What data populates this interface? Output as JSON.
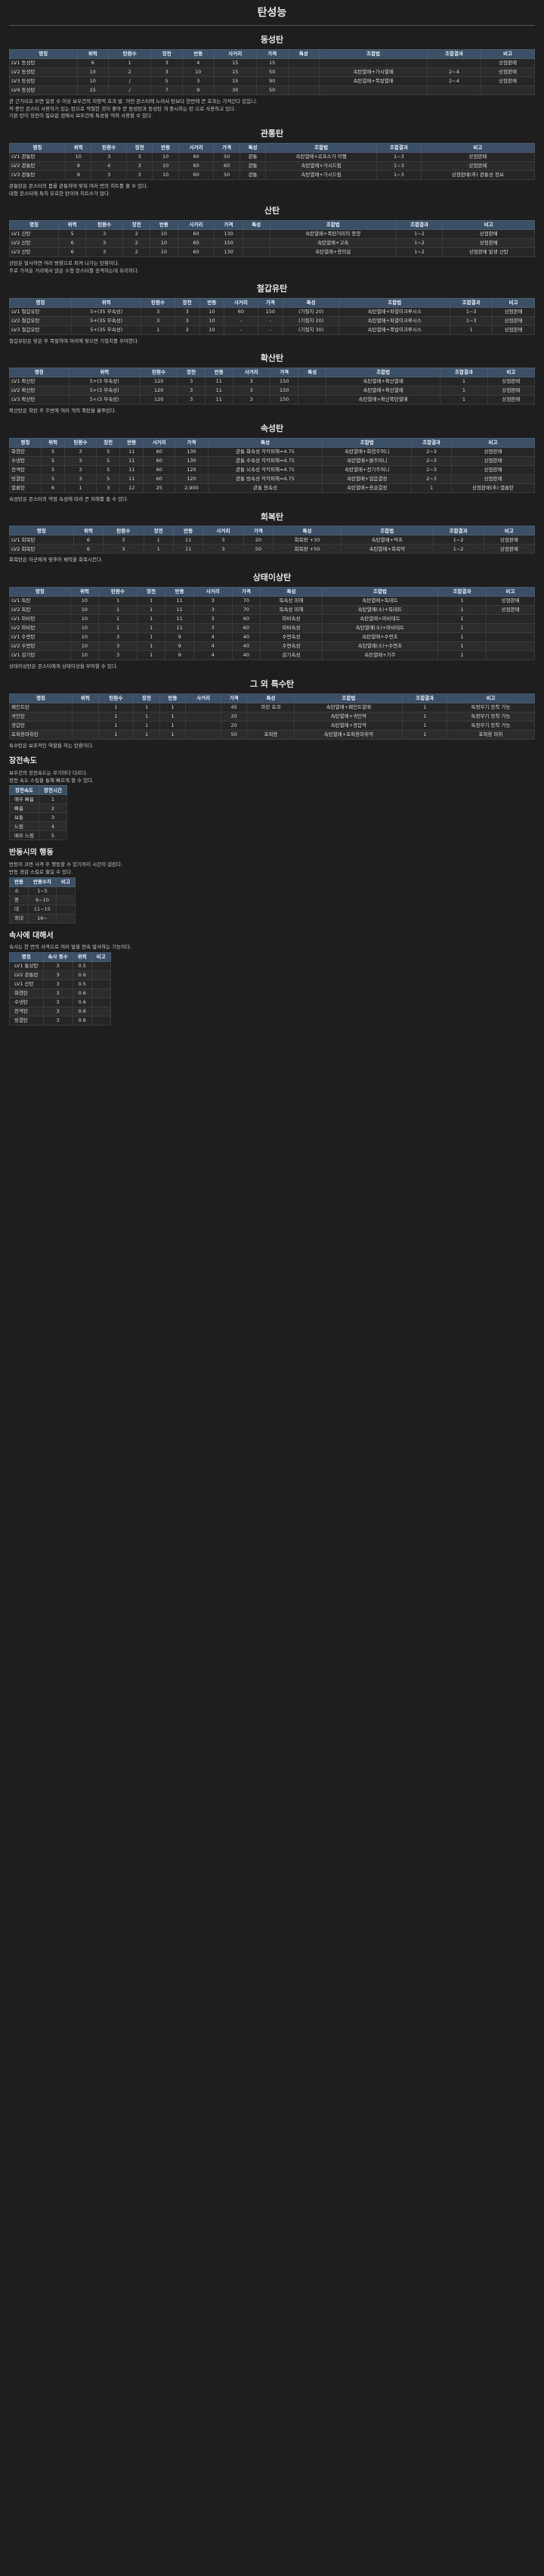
{
  "title": "탄성능",
  "sections": [
    {
      "title": "동성탄",
      "headers": [
        "명칭",
        "위력",
        "탄환수",
        "장전",
        "반동",
        "사거리",
        "가격",
        "특성",
        "조합법",
        "조합결과",
        "비고"
      ],
      "rows": [
        [
          "LV1 동성탄",
          "6",
          "1",
          "3",
          "4",
          "15",
          "15",
          "",
          "",
          "",
          "상점판매"
        ],
        [
          "LV2 동성탄",
          "10",
          "2",
          "3",
          "10",
          "15",
          "50",
          "",
          "속탄열매+가시열매",
          "2~4",
          "상점판매"
        ],
        [
          "LV3 동성탄",
          "10",
          "/",
          "5",
          "3",
          "15",
          "90",
          "",
          "속탄열매+폭발열매",
          "2~4",
          "상점판매"
        ],
        [
          "LV4 동성탄",
          "15",
          "/",
          "7",
          "9",
          "30",
          "50",
          "",
          "",
          "",
          ""
        ]
      ],
      "notes": [
        "관 근거리로 쓰면 일정 수 이상 보우건의 치명적 효과 발. 어떤 몬스터에 노려서 탄보다 한번에 큰 효과는 가져간다 있음니.",
        "적 중인 몬스터 사용하기 있는 탄으로 적절한 것이 좋아 양 동성탄과 동성탄 개 중시하는 탄 으로 사용하고 있다.",
        "기본 탄이 장전이 필요없 점에서 보우건에 특성을 익혀 사용할 수 있다."
      ]
    },
    {
      "title": "관통탄",
      "headers": [
        "명칭",
        "위력",
        "탄환수",
        "장전",
        "반동",
        "사거리",
        "가격",
        "특성",
        "조합법",
        "조합결과",
        "비고"
      ],
      "rows": [
        [
          "LV1 관통탄",
          "10",
          "3",
          "3",
          "10",
          "60",
          "50",
          "관통",
          "속탄열매+로프스가 이빨",
          "1~3",
          "상점판매"
        ],
        [
          "LV2 관통탄",
          "9",
          "4",
          "3",
          "10",
          "60",
          "60",
          "관통",
          "속탄열매+가시드림",
          "1~3",
          "상점판매"
        ],
        [
          "LV3 관통탄",
          "9",
          "3",
          "3",
          "10",
          "60",
          "50",
          "관통",
          "속탄열매+가시드림",
          "1~3",
          "상점판매(추) 관통성 정보"
        ]
      ],
      "notes": [
        "관통탄은 몬스터의 몸을 관통하며 맞춰 여러 번의 히트를 줄 수 있다.",
        "대형 몬스터에 특히 유효한 탄이며 히트수가 많다."
      ]
    },
    {
      "title": "산탄",
      "headers": [
        "명칭",
        "위력",
        "탄환수",
        "장전",
        "반동",
        "사거리",
        "가격",
        "특성",
        "조합법",
        "조합결과",
        "비고"
      ],
      "rows": [
        [
          "LV1 산탄",
          "5",
          "3",
          "2",
          "10",
          "60",
          "130",
          "",
          "속탄열매+폭탄거미의 종양",
          "1~2",
          "상점판매"
        ],
        [
          "LV2 산탄",
          "6",
          "3",
          "2",
          "10",
          "60",
          "150",
          "",
          "속탄열매+고속",
          "1~2",
          "상점판매"
        ],
        [
          "LV3 산탄",
          "6",
          "3",
          "2",
          "10",
          "60",
          "130",
          "",
          "속탄열매+용의살",
          "1~2",
          "상점판매 발생 산탄"
        ]
      ],
      "notes": [
        "산탄은 발사하면 여러 방향으로 퍼져 나가는 탄환이다.",
        "주로 가까운 거리에서 많은 소형 몬스터를 공격하는데 유리하다."
      ]
    },
    {
      "title": "철갑유탄",
      "headers": [
        "명칭",
        "위력",
        "탄환수",
        "장전",
        "반동",
        "사거리",
        "가격",
        "특성",
        "조합법",
        "조합결과",
        "비고"
      ],
      "rows": [
        [
          "LV1 철갑유탄",
          "5+(35 무속성)",
          "3",
          "3",
          "10",
          "60",
          "150",
          "(기절치 20)",
          "속탄열매+파열이크루시스",
          "1~3",
          "상점판매"
        ],
        [
          "LV2 철갑유탄",
          "5+(35 무속성)",
          "3",
          "3",
          "10",
          "-",
          "-",
          "(기절치 20)",
          "속탄열매+파열이크루시스",
          "1~3",
          "상점판매"
        ],
        [
          "LV3 철갑유탄",
          "5+(35 무속성)",
          "1",
          "3",
          "10",
          "-",
          "-",
          "(기절치 30)",
          "속탄열매+폭발이크루시스",
          "1",
          "상점판매"
        ]
      ],
      "notes": [
        "철갑유탄은 맞은 후 폭발하며 머리에 맞으면 기절치를 부여한다."
      ]
    },
    {
      "title": "확산탄",
      "headers": [
        "명칭",
        "위력",
        "탄환수",
        "장전",
        "반동",
        "사거리",
        "가격",
        "특성",
        "조합법",
        "조합결과",
        "비고"
      ],
      "rows": [
        [
          "LV1 확산탄",
          "5+(3 무속성)",
          "120",
          "3",
          "11",
          "3",
          "150",
          "",
          "속탄열매+확산열매",
          "1",
          "상점판매"
        ],
        [
          "LV2 확산탄",
          "5+(3 무속성)",
          "120",
          "3",
          "11",
          "3",
          "150",
          "",
          "속탄열매+확산열매",
          "1",
          "상점판매"
        ],
        [
          "LV3 확산탄",
          "5+(3 무속성)",
          "120",
          "3",
          "11",
          "3",
          "150",
          "",
          "속탄열매+확산폭탄열매",
          "1",
          "상점판매"
        ]
      ],
      "notes": [
        "확산탄은 착탄 후 주변에 여러 개의 폭탄을 흩뿌린다."
      ]
    },
    {
      "title": "속성탄",
      "headers": [
        "명칭",
        "위력",
        "탄환수",
        "장전",
        "반동",
        "사거리",
        "가격",
        "특성",
        "조합법",
        "조합결과",
        "비고"
      ],
      "rows": [
        [
          "화염탄",
          "5",
          "3",
          "5",
          "11",
          "60",
          "130",
          "관통 화속성 각각피해=4.75",
          "속탄열매+화염주머니",
          "2~3",
          "상점판매"
        ],
        [
          "수냉탄",
          "5",
          "3",
          "5",
          "11",
          "60",
          "130",
          "관통 수속성 각각피해=4.75",
          "속탄열매+물주머니",
          "2~3",
          "상점판매"
        ],
        [
          "전격탄",
          "5",
          "3",
          "5",
          "11",
          "60",
          "120",
          "관통 뇌속성 각각피해=4.75",
          "속탄열매+전기주머니",
          "2~3",
          "상점판매"
        ],
        [
          "빙결탄",
          "5",
          "3",
          "5",
          "11",
          "60",
          "120",
          "관통 빙속성 각각피해=4.75",
          "속탄열매+얼음결정",
          "2~3",
          "상점판매"
        ],
        [
          "멸룡탄",
          "6",
          "1",
          "3",
          "12",
          "25",
          "2,900",
          "관통 용속성",
          "속탄열매+용골결정",
          "1",
          "상점판매(추) 멸룡탄"
        ]
      ],
      "notes": [
        "속성탄은 몬스터의 약점 속성에 따라 큰 피해를 줄 수 있다."
      ]
    },
    {
      "title": "회복탄",
      "headers": [
        "명칭",
        "위력",
        "탄환수",
        "장전",
        "반동",
        "사거리",
        "가격",
        "특성",
        "조합법",
        "조합결과",
        "비고"
      ],
      "rows": [
        [
          "LV1 회복탄",
          "6",
          "3",
          "1",
          "11",
          "3",
          "20",
          "회복량 +30",
          "속탄열매+약초",
          "1~2",
          "상점판매"
        ],
        [
          "LV2 회복탄",
          "6",
          "3",
          "1",
          "11",
          "3",
          "50",
          "회복량 +50",
          "속탄열매+회복약",
          "1~2",
          "상점판매"
        ]
      ],
      "notes": [
        "회복탄은 아군에게 맞추어 체력을 회복시킨다."
      ]
    },
    {
      "title": "상태이상탄",
      "headers": [
        "명칭",
        "위력",
        "탄환수",
        "장전",
        "반동",
        "사거리",
        "가격",
        "특성",
        "조합법",
        "조합결과",
        "비고"
      ],
      "rows": [
        [
          "LV1 독탄",
          "10",
          "1",
          "1",
          "11",
          "3",
          "70",
          "독속성 피해",
          "속탄열매+독테트",
          "1",
          "상점판매"
        ],
        [
          "LV2 독탄",
          "10",
          "1",
          "1",
          "11",
          "3",
          "70",
          "독속성 피해",
          "속탄열매(소)+독테트",
          "1",
          "상점판매"
        ],
        [
          "LV1 마비탄",
          "10",
          "1",
          "1",
          "11",
          "3",
          "60",
          "마비속성",
          "속탄열매+마비테트",
          "1",
          ""
        ],
        [
          "LV2 마비탄",
          "10",
          "1",
          "1",
          "11",
          "3",
          "60",
          "마비속성",
          "속탄열매(소)+마비테트",
          "1",
          ""
        ],
        [
          "LV1 수면탄",
          "10",
          "3",
          "1",
          "9",
          "4",
          "40",
          "수면속성",
          "속탄열매+수면초",
          "1",
          ""
        ],
        [
          "LV2 수면탄",
          "10",
          "3",
          "1",
          "9",
          "4",
          "40",
          "수면속성",
          "속탄열매(소)+수면초",
          "1",
          ""
        ],
        [
          "LV1 감기탄",
          "10",
          "3",
          "1",
          "9",
          "4",
          "40",
          "감기속성",
          "속탄열매+기주",
          "1",
          ""
        ]
      ],
      "notes": [
        "상태이상탄은 몬스터에게 상태이상을 부여할 수 있다."
      ]
    },
    {
      "title": "그 외 특수탄",
      "headers": [
        "명칭",
        "위력",
        "탄환수",
        "장전",
        "반동",
        "사거리",
        "가격",
        "특성",
        "조합법",
        "조합결과",
        "비고"
      ],
      "rows": [
        [
          "페인트탄",
          "",
          "1",
          "1",
          "1",
          "",
          "45",
          "마킹 효과",
          "속탄열매+페인트열매",
          "1",
          "특정무기 장착 가능"
        ],
        [
          "귀인탄",
          "",
          "1",
          "1",
          "1",
          "",
          "20",
          "",
          "속탄열매+귀인약",
          "1",
          "특정무기 장착 가능"
        ],
        [
          "경갑탄",
          "",
          "1",
          "1",
          "1",
          "",
          "20",
          "",
          "속탄열매+경갑약",
          "1",
          "특정무기 장착 가능"
        ],
        [
          "포획용마취탄",
          "",
          "1",
          "1",
          "1",
          "",
          "50",
          "포획용",
          "속탄열매+포획용마취약",
          "1",
          "포획용 마취"
        ]
      ],
      "notes": [
        "특수탄은 보조적인 역할을 하는 탄환이다."
      ]
    }
  ],
  "reload": {
    "title": "장전속도",
    "notes": [
      "보우건의 장전속도는 무기마다 다르다.",
      "장전 속도 스킬을 통해 빠르게 할 수 있다."
    ],
    "headers": [
      "장전속도",
      "장전시간"
    ],
    "rows": [
      [
        "매우 빠름",
        "1"
      ],
      [
        "빠름",
        "2"
      ],
      [
        "보통",
        "3"
      ],
      [
        "느림",
        "4"
      ],
      [
        "매우 느림",
        "5"
      ]
    ]
  },
  "recoil": {
    "title": "반동시의 행동",
    "notes": [
      "반동이 크면 사격 후 행동할 수 있기까지 시간이 걸린다.",
      "반동 경감 스킬로 줄일 수 있다."
    ],
    "headers": [
      "반동",
      "반동수치",
      "비고"
    ],
    "rows": [
      [
        "소",
        "1~5",
        ""
      ],
      [
        "중",
        "6~10",
        ""
      ],
      [
        "대",
        "11~15",
        ""
      ],
      [
        "최대",
        "16~",
        ""
      ]
    ]
  },
  "speed": {
    "title": "속사에 대해서",
    "notes": [
      "속사는 한 번의 사격으로 여러 발을 연속 발사하는 기능이다."
    ],
    "headers": [
      "명칭",
      "속사 횟수",
      "위력",
      "비고"
    ],
    "rows": [
      [
        "LV1 통상탄",
        "3",
        "0.5",
        ""
      ],
      [
        "LV2 관통탄",
        "3",
        "0.6",
        ""
      ],
      [
        "LV1 산탄",
        "3",
        "0.5",
        ""
      ],
      [
        "화염탄",
        "3",
        "0.6",
        ""
      ],
      [
        "수냉탄",
        "3",
        "0.6",
        ""
      ],
      [
        "전격탄",
        "3",
        "0.6",
        ""
      ],
      [
        "빙결탄",
        "3",
        "0.6",
        ""
      ]
    ]
  }
}
